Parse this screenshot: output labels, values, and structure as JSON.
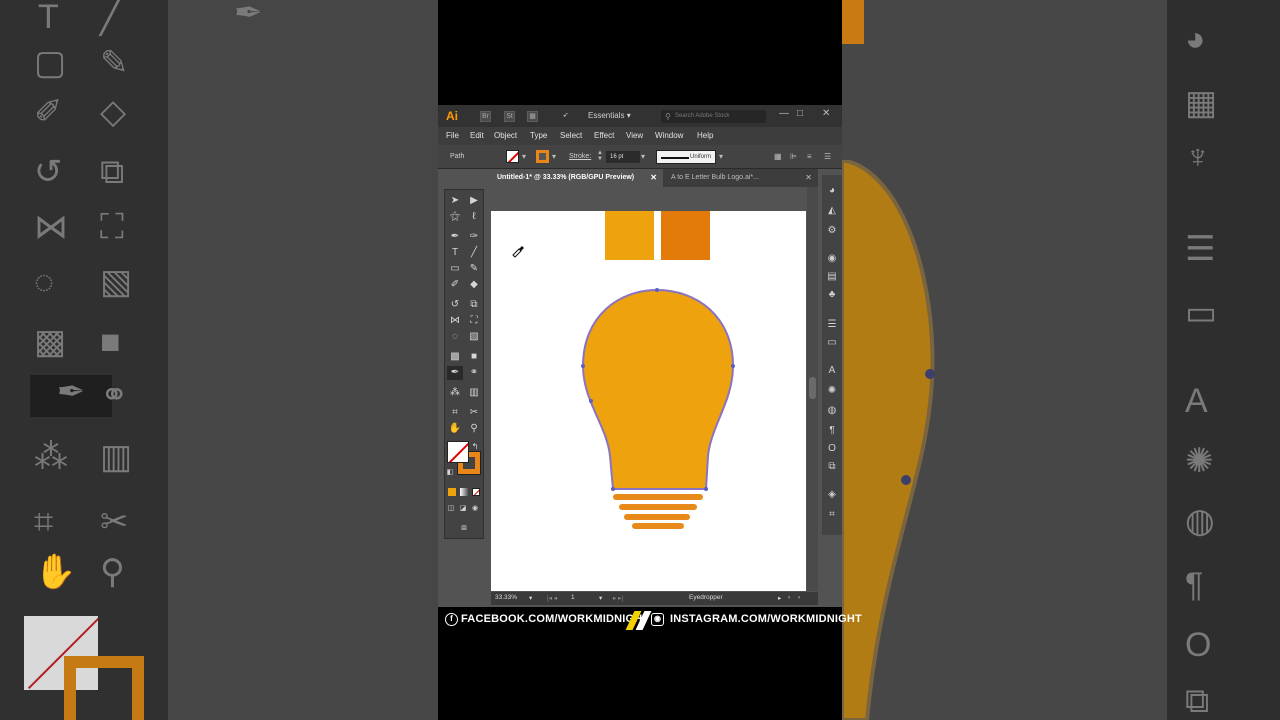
{
  "titlebar": {
    "app_logo": "Ai",
    "workspace": "Essentials",
    "search_placeholder": "Search Adobe Stock",
    "minimize": "—",
    "maximize": "□",
    "close": "✕"
  },
  "menubar": {
    "items": [
      "File",
      "Edit",
      "Object",
      "Type",
      "Select",
      "Effect",
      "View",
      "Window",
      "Help"
    ]
  },
  "controlbar": {
    "selection_type": "Path",
    "stroke_label": "Stroke:",
    "stroke_weight": "16 pt",
    "stroke_profile": "Uniform",
    "fill_color": "none",
    "stroke_color": "#e8861a"
  },
  "tabs": [
    {
      "label": "Untitled-1* @ 33.33% (RGB/GPU Preview)",
      "close": "✕"
    },
    {
      "label": "A to E Letter Bulb Logo.ai*...",
      "close": "✕"
    }
  ],
  "statusbar": {
    "zoom": "33.33%",
    "artboard_number": "1",
    "current_tool": "Eyedropper"
  },
  "artboard": {
    "swatch_colors": [
      "#eda20e",
      "#e27b0a"
    ],
    "bulb_fill": "#eda20e",
    "bulb_outline": "#8a73c2",
    "base_stripe_color": "#e88a1a",
    "base_stripe_count": 4
  },
  "banner": {
    "facebook": "FACEBOOK.COM/WORKMIDNIGHT",
    "instagram": "INSTAGRAM.COM/WORKMIDNIGHT"
  }
}
